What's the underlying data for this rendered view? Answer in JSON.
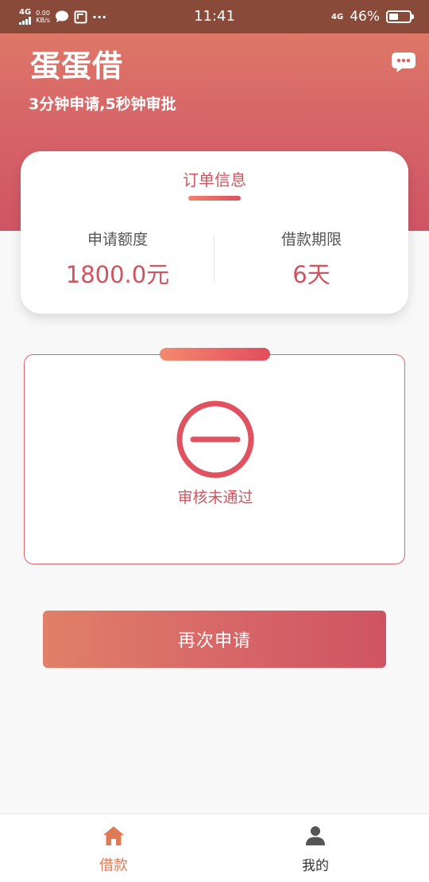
{
  "status_bar": {
    "network_left": "4G",
    "speed_value": "0.00",
    "speed_unit": "KB/s",
    "more": "···",
    "time": "11:41",
    "network_right": "4G",
    "battery": "46%",
    "battery_level": 0.46
  },
  "header": {
    "title": "蛋蛋借",
    "slogan": "3分钟申请,5秒钟审批"
  },
  "order_info": {
    "title": "订单信息",
    "amount_label": "申请额度",
    "amount_value": "1800.0元",
    "term_label": "借款期限",
    "term_value": "6天"
  },
  "review": {
    "status_text": "审核未通过"
  },
  "actions": {
    "reapply_label": "再次申请"
  },
  "bottom_nav": {
    "items": [
      {
        "label": "借款",
        "icon": "home-icon",
        "active": true
      },
      {
        "label": "我的",
        "icon": "user-icon",
        "active": false
      }
    ]
  },
  "colors": {
    "accent": "#d0545f",
    "nav_active": "#e07a55",
    "header_top": "#e07f66",
    "header_bottom": "#cf5564",
    "status_bar": "#8a4a3a"
  }
}
